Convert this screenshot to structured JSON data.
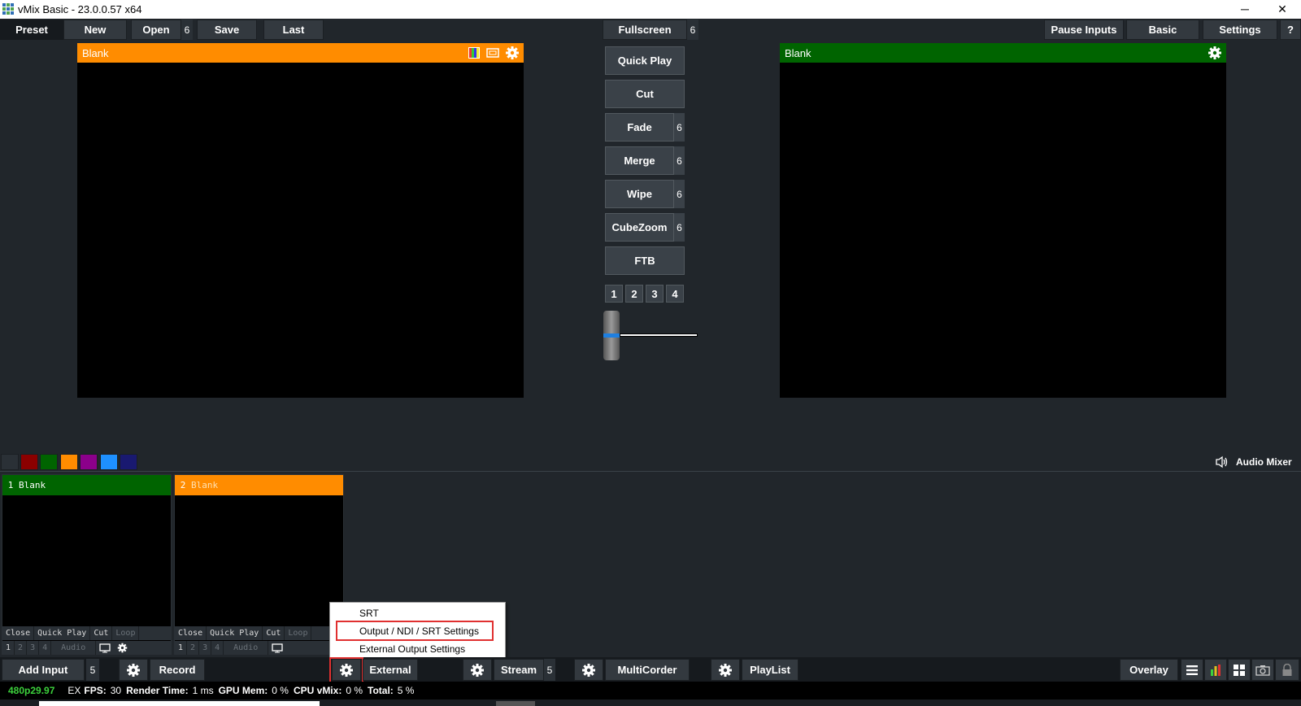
{
  "window": {
    "title": "vMix Basic - 23.0.0.57 x64",
    "minimize": "─",
    "restore": "❐",
    "close": "✕"
  },
  "toolbar": {
    "preset": "Preset",
    "new": "New",
    "open": "Open",
    "open_count": "6",
    "save": "Save",
    "last": "Last",
    "fullscreen": "Fullscreen",
    "fullscreen_count": "6",
    "pause_inputs": "Pause Inputs",
    "basic": "Basic",
    "settings": "Settings",
    "help": "?"
  },
  "preview": {
    "title": "Blank"
  },
  "output": {
    "title": "Blank"
  },
  "transitions": {
    "quick_play": "Quick Play",
    "cut": "Cut",
    "fade": "Fade",
    "fade_count": "6",
    "merge": "Merge",
    "merge_count": "6",
    "wipe": "Wipe",
    "wipe_count": "6",
    "cubezoom": "CubeZoom",
    "cubezoom_count": "6",
    "ftb": "FTB",
    "numbers": [
      "1",
      "2",
      "3",
      "4"
    ]
  },
  "color_tags": [
    "#2a3036",
    "#8b0000",
    "#006400",
    "#ff8c00",
    "#8b008b",
    "#1e90ff",
    "#191970"
  ],
  "audio_mixer": {
    "label": "Audio Mixer"
  },
  "inputs": [
    {
      "number": "1",
      "title": "Blank",
      "header_color": "#006400",
      "text_color": "#ffffff"
    },
    {
      "number": "2",
      "title": "Blank",
      "header_color": "#ff8c00",
      "text_color": "#ffe0b0"
    }
  ],
  "tile_controls": {
    "close": "Close",
    "quick_play": "Quick Play",
    "cut": "Cut",
    "loop": "Loop",
    "numbers": [
      "1",
      "2",
      "3",
      "4"
    ],
    "audio": "Audio"
  },
  "context_menu": {
    "items": [
      "SRT",
      "Output / NDI / SRT Settings",
      "External Output Settings"
    ]
  },
  "bottombar": {
    "add_input": "Add Input",
    "add_input_count": "5",
    "record": "Record",
    "external": "External",
    "stream": "Stream",
    "stream_count": "5",
    "multicorder": "MultiCorder",
    "playlist": "PlayList",
    "overlay": "Overlay"
  },
  "status": {
    "format": "480p29.97",
    "ex": "EX",
    "fps_label": "FPS:",
    "fps": "30",
    "render_label": "Render Time:",
    "render": "1 ms",
    "gpu_label": "GPU Mem:",
    "gpu": "0 %",
    "cpu_label": "CPU vMix:",
    "cpu": "0 %",
    "total_label": "Total:",
    "total": "5 %"
  },
  "colors": {
    "background": "#21262b",
    "preview_header": "#ff8c00",
    "output_header": "#006400",
    "status_green": "#3cd13c",
    "highlight_red": "#e03030"
  }
}
